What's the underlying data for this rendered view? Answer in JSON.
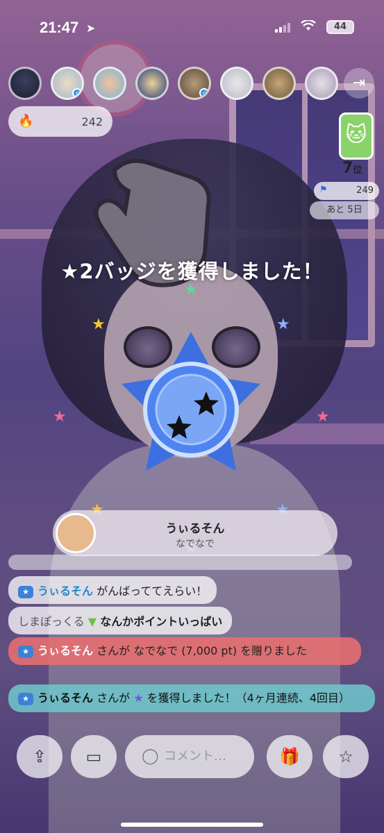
{
  "status_bar": {
    "time": "21:47",
    "battery": "44"
  },
  "top": {
    "avatars_count": 8,
    "fire_count": "242"
  },
  "ranking": {
    "rank": "7",
    "rank_suffix": "位",
    "points": "249",
    "days_left": "あと 5日"
  },
  "announcement": "★2バッジを獲得しました！",
  "gift_popup": {
    "user": "うぃるそん",
    "gift": "なでなで"
  },
  "chat": {
    "messages": [
      {
        "user": "うぃるそん",
        "text": "がんばっててえらい！"
      },
      {
        "user": "しまぽっくる",
        "text": "なんかポイントいっぱい"
      },
      {
        "user": "うぃるそん",
        "text": "さんが なでなで (7,000 pt) を贈りました"
      },
      {
        "user": "うぃるそん",
        "text": "さんが",
        "text2": "を獲得しました！（4ヶ月連続、4回目）"
      }
    ]
  },
  "bottom": {
    "comment_placeholder": "コメント…"
  },
  "icons": [
    "location-arrow-icon",
    "signal-icon",
    "wifi-icon",
    "exit-icon",
    "fire-icon",
    "flag-icon",
    "share-icon",
    "screen-icon",
    "chat-bubble-icon",
    "gift-icon",
    "star-icon"
  ]
}
